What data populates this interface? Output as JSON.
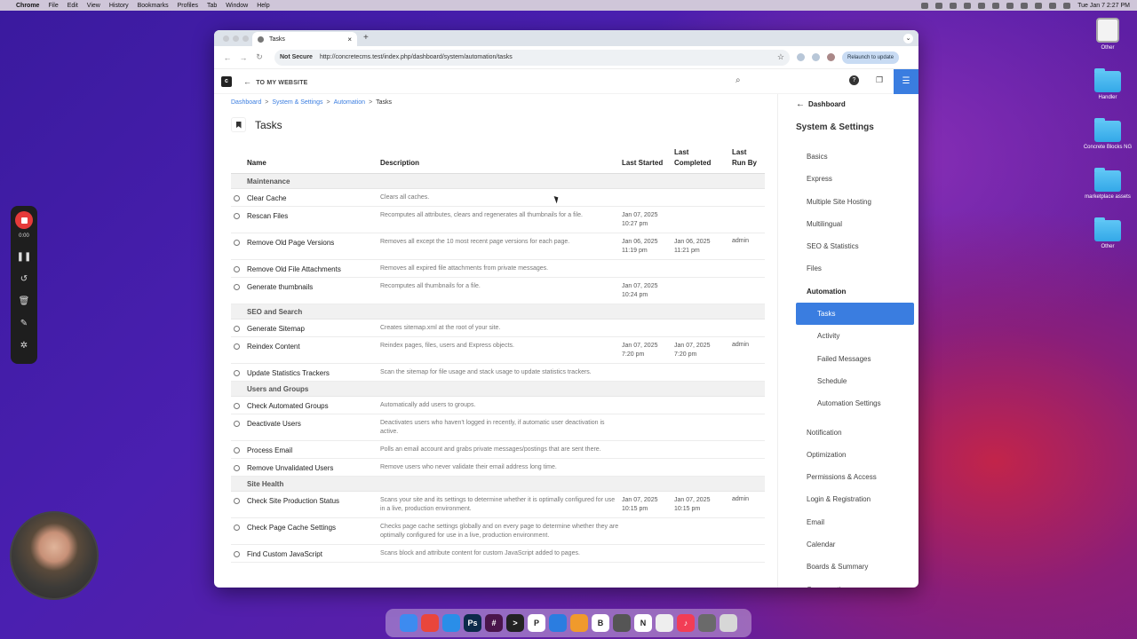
{
  "menubar": {
    "app": "Chrome",
    "items": [
      "File",
      "Edit",
      "View",
      "History",
      "Bookmarks",
      "Profiles",
      "Tab",
      "Window",
      "Help"
    ],
    "clock": "Tue Jan 7  2:27 PM"
  },
  "desktop": {
    "icons": [
      {
        "label": "Other",
        "kind": "drive"
      },
      {
        "label": "Handler",
        "kind": "folder"
      },
      {
        "label": "Concrete Blocks NG",
        "kind": "folder"
      },
      {
        "label": "marketplace assets",
        "kind": "folder"
      },
      {
        "label": "Other",
        "kind": "folder"
      }
    ]
  },
  "recorder": {
    "time": "0:00"
  },
  "browser": {
    "tab_title": "Tasks",
    "security": "Not Secure",
    "url": "http://concretecms.test/index.php/dashboard/system/automation/tasks",
    "relaunch": "Relaunch to update"
  },
  "toolbar": {
    "to_website": "TO MY WEBSITE"
  },
  "breadcrumb": [
    "Dashboard",
    "System & Settings",
    "Automation",
    "Tasks"
  ],
  "page_title": "Tasks",
  "table": {
    "headers": {
      "name": "Name",
      "description": "Description",
      "last_started": "Last Started",
      "last_completed": "Last Completed",
      "last_run_by": "Last Run By"
    },
    "groups": [
      {
        "title": "Maintenance",
        "rows": [
          {
            "name": "Clear Cache",
            "desc": "Clears all caches.",
            "started": "",
            "completed": "",
            "by": ""
          },
          {
            "name": "Rescan Files",
            "desc": "Recomputes all attributes, clears and regenerates all thumbnails for a file.",
            "started": "Jan 07, 2025 10:27 pm",
            "completed": "",
            "by": ""
          },
          {
            "name": "Remove Old Page Versions",
            "desc": "Removes all except the 10 most recent page versions for each page.",
            "started": "Jan 06, 2025 11:19 pm",
            "completed": "Jan 06, 2025 11:21 pm",
            "by": "admin"
          },
          {
            "name": "Remove Old File Attachments",
            "desc": "Removes all expired file attachments from private messages.",
            "started": "",
            "completed": "",
            "by": ""
          },
          {
            "name": "Generate thumbnails",
            "desc": "Recomputes all thumbnails for a file.",
            "started": "Jan 07, 2025 10:24 pm",
            "completed": "",
            "by": ""
          }
        ]
      },
      {
        "title": "SEO and Search",
        "rows": [
          {
            "name": "Generate Sitemap",
            "desc": "Creates sitemap.xml at the root of your site.",
            "started": "",
            "completed": "",
            "by": ""
          },
          {
            "name": "Reindex Content",
            "desc": "Reindex pages, files, users and Express objects.",
            "started": "Jan 07, 2025 7:20 pm",
            "completed": "Jan 07, 2025 7:20 pm",
            "by": "admin"
          },
          {
            "name": "Update Statistics Trackers",
            "desc": "Scan the sitemap for file usage and stack usage to update statistics trackers.",
            "started": "",
            "completed": "",
            "by": ""
          }
        ]
      },
      {
        "title": "Users and Groups",
        "rows": [
          {
            "name": "Check Automated Groups",
            "desc": "Automatically add users to groups.",
            "started": "",
            "completed": "",
            "by": ""
          },
          {
            "name": "Deactivate Users",
            "desc": "Deactivates users who haven't logged in recently, if automatic user deactivation is active.",
            "started": "",
            "completed": "",
            "by": ""
          },
          {
            "name": "Process Email",
            "desc": "Polls an email account and grabs private messages/postings that are sent there.",
            "started": "",
            "completed": "",
            "by": ""
          },
          {
            "name": "Remove Unvalidated Users",
            "desc": "Remove users who never validate their email address long time.",
            "started": "",
            "completed": "",
            "by": ""
          }
        ]
      },
      {
        "title": "Site Health",
        "rows": [
          {
            "name": "Check Site Production Status",
            "desc": "Scans your site and its settings to determine whether it is optimally configured for use in a live, production environment.",
            "started": "Jan 07, 2025 10:15 pm",
            "completed": "Jan 07, 2025 10:15 pm",
            "by": "admin"
          },
          {
            "name": "Check Page Cache Settings",
            "desc": "Checks page cache settings globally and on every page to determine whether they are optimally configured for use in a live, production environment.",
            "started": "",
            "completed": "",
            "by": ""
          },
          {
            "name": "Find Custom JavaScript",
            "desc": "Scans block and attribute content for custom JavaScript added to pages.",
            "started": "",
            "completed": "",
            "by": ""
          }
        ]
      }
    ]
  },
  "sidebar": {
    "back": "Dashboard",
    "title": "System & Settings",
    "items": [
      {
        "label": "Basics",
        "type": "item"
      },
      {
        "label": "Express",
        "type": "item"
      },
      {
        "label": "Multiple Site Hosting",
        "type": "item"
      },
      {
        "label": "Multilingual",
        "type": "item"
      },
      {
        "label": "SEO & Statistics",
        "type": "item"
      },
      {
        "label": "Files",
        "type": "item"
      },
      {
        "label": "Automation",
        "type": "active"
      },
      {
        "label": "Tasks",
        "type": "selected"
      },
      {
        "label": "Activity",
        "type": "sub"
      },
      {
        "label": "Failed Messages",
        "type": "sub"
      },
      {
        "label": "Schedule",
        "type": "sub"
      },
      {
        "label": "Automation Settings",
        "type": "sub"
      },
      {
        "label": "Notification",
        "type": "gap"
      },
      {
        "label": "Optimization",
        "type": "item"
      },
      {
        "label": "Permissions & Access",
        "type": "item"
      },
      {
        "label": "Login & Registration",
        "type": "item"
      },
      {
        "label": "Email",
        "type": "item"
      },
      {
        "label": "Calendar",
        "type": "item"
      },
      {
        "label": "Boards & Summary",
        "type": "item"
      },
      {
        "label": "Conversations",
        "type": "item"
      }
    ]
  },
  "dock": {
    "apps": [
      {
        "name": "finder",
        "color": "#3d8bf0",
        "glyph": ""
      },
      {
        "name": "chrome",
        "color": "#e9463b",
        "glyph": ""
      },
      {
        "name": "safari",
        "color": "#2a8ee8",
        "glyph": ""
      },
      {
        "name": "photoshop",
        "color": "#0c2a4a",
        "glyph": "Ps"
      },
      {
        "name": "slack",
        "color": "#4a154b",
        "glyph": "#"
      },
      {
        "name": "terminal",
        "color": "#222222",
        "glyph": ">"
      },
      {
        "name": "p-app",
        "color": "#ffffff",
        "glyph": "P"
      },
      {
        "name": "cloud-app",
        "color": "#2b7de0",
        "glyph": ""
      },
      {
        "name": "pencil-app",
        "color": "#f09a2c",
        "glyph": ""
      },
      {
        "name": "bbedit",
        "color": "#ffffff",
        "glyph": "B"
      },
      {
        "name": "calculator",
        "color": "#555555",
        "glyph": ""
      },
      {
        "name": "notion",
        "color": "#ffffff",
        "glyph": "N"
      },
      {
        "name": "script-app",
        "color": "#eeeeee",
        "glyph": ""
      },
      {
        "name": "music",
        "color": "#f23d55",
        "glyph": "♪"
      },
      {
        "name": "photo-app",
        "color": "#6a6a6a",
        "glyph": ""
      },
      {
        "name": "trash",
        "color": "#d7d7d7",
        "glyph": ""
      }
    ]
  }
}
